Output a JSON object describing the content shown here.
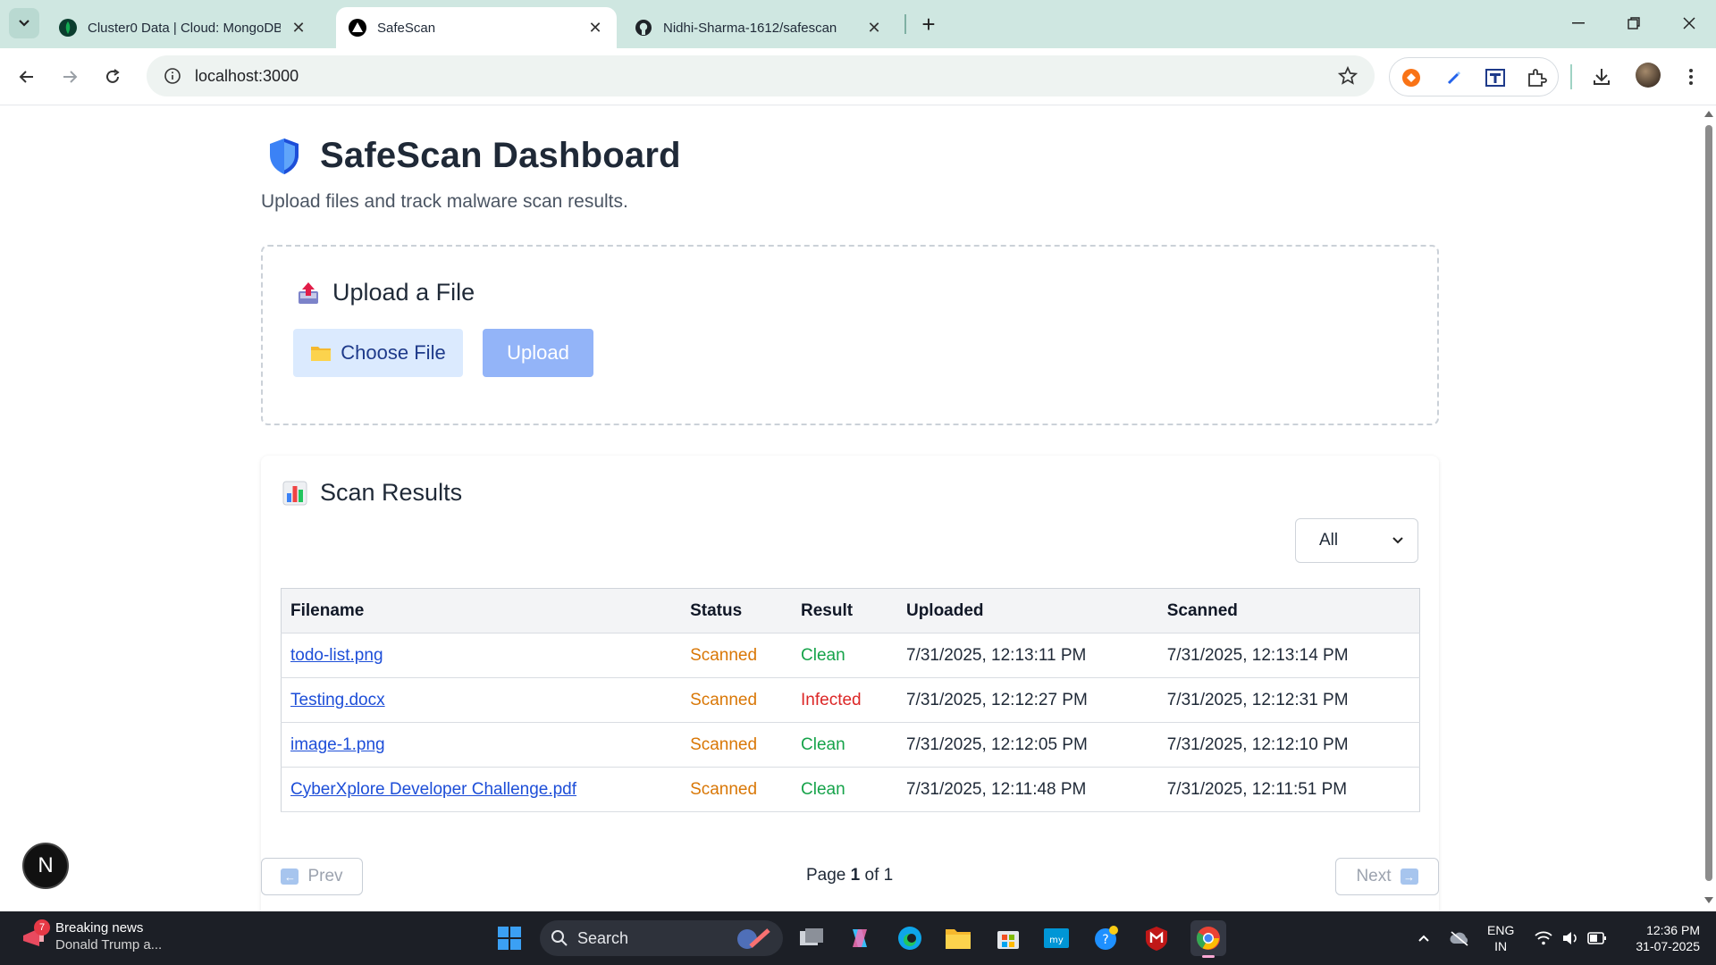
{
  "browser": {
    "tabs": [
      {
        "title": "Cluster0 Data | Cloud: MongoDB Cloud",
        "active": false,
        "favicon": "mongodb-leaf-icon"
      },
      {
        "title": "SafeScan",
        "active": true,
        "favicon": "triangle-logo-icon"
      },
      {
        "title": "Nidhi-Sharma-1612/safescan",
        "active": false,
        "favicon": "github-icon"
      }
    ],
    "url": "localhost:3000"
  },
  "page": {
    "title": "SafeScan Dashboard",
    "subtitle": "Upload files and track malware scan results.",
    "upload": {
      "title": "Upload a File",
      "choose_label": "Choose File",
      "upload_label": "Upload"
    },
    "results": {
      "title": "Scan Results",
      "filter_value": "All",
      "columns": [
        "Filename",
        "Status",
        "Result",
        "Uploaded",
        "Scanned"
      ],
      "rows": [
        {
          "filename": "todo-list.png",
          "status": "Scanned",
          "result": "Clean",
          "uploaded": "7/31/2025, 12:13:11 PM",
          "scanned": "7/31/2025, 12:13:14 PM"
        },
        {
          "filename": "Testing.docx",
          "status": "Scanned",
          "result": "Infected",
          "uploaded": "7/31/2025, 12:12:27 PM",
          "scanned": "7/31/2025, 12:12:31 PM"
        },
        {
          "filename": "image-1.png",
          "status": "Scanned",
          "result": "Clean",
          "uploaded": "7/31/2025, 12:12:05 PM",
          "scanned": "7/31/2025, 12:12:10 PM"
        },
        {
          "filename": "CyberXplore Developer Challenge.pdf",
          "status": "Scanned",
          "result": "Clean",
          "uploaded": "7/31/2025, 12:11:48 PM",
          "scanned": "7/31/2025, 12:11:51 PM"
        }
      ]
    },
    "pagination": {
      "prev_label": "Prev",
      "next_label": "Next",
      "page_prefix": "Page",
      "current": "1",
      "of_label": "of",
      "total": "1"
    },
    "dev_badge": "N"
  },
  "taskbar": {
    "news_line1": "Breaking news",
    "news_line2": "Donald Trump a...",
    "news_badge": "7",
    "search_label": "Search",
    "lang_line1": "ENG",
    "lang_line2": "IN",
    "time": "12:36 PM",
    "date": "31-07-2025"
  },
  "colors": {
    "accent_blue": "#1d4ed8",
    "status_scanned": "#d97706",
    "result_clean": "#16a34a",
    "result_infected": "#dc2626"
  }
}
